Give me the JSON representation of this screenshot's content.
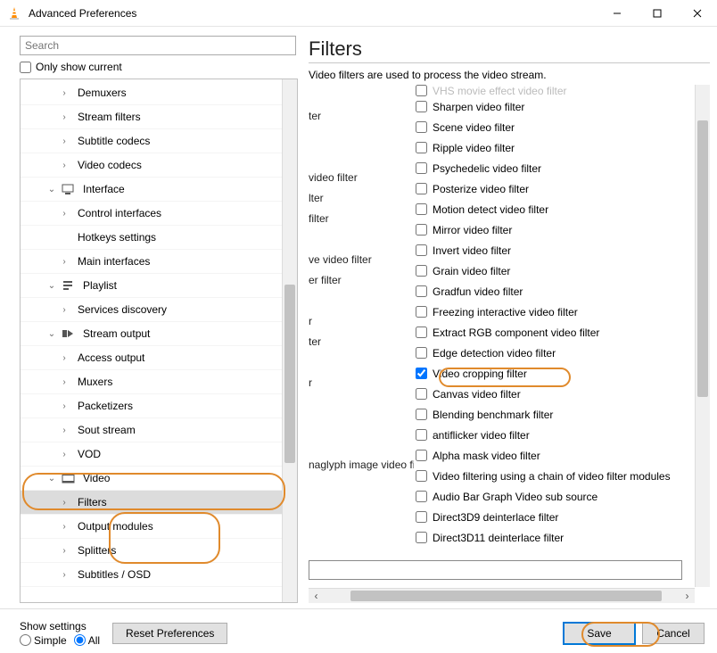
{
  "window": {
    "title": "Advanced Preferences"
  },
  "search": {
    "placeholder": "Search"
  },
  "only_current_label": "Only show current",
  "tree": [
    {
      "level": 2,
      "arrow": "›",
      "label": "Demuxers"
    },
    {
      "level": 2,
      "arrow": "›",
      "label": "Stream filters"
    },
    {
      "level": 2,
      "arrow": "›",
      "label": "Subtitle codecs"
    },
    {
      "level": 2,
      "arrow": "›",
      "label": "Video codecs"
    },
    {
      "level": 1,
      "arrow": "⌄",
      "icon": "iface",
      "label": "Interface"
    },
    {
      "level": 2,
      "arrow": "›",
      "label": "Control interfaces"
    },
    {
      "level": 2,
      "arrow": "",
      "label": "Hotkeys settings"
    },
    {
      "level": 2,
      "arrow": "›",
      "label": "Main interfaces"
    },
    {
      "level": 1,
      "arrow": "⌄",
      "icon": "playlist",
      "label": "Playlist"
    },
    {
      "level": 2,
      "arrow": "›",
      "label": "Services discovery"
    },
    {
      "level": 1,
      "arrow": "⌄",
      "icon": "stream",
      "label": "Stream output"
    },
    {
      "level": 2,
      "arrow": "›",
      "label": "Access output"
    },
    {
      "level": 2,
      "arrow": "›",
      "label": "Muxers"
    },
    {
      "level": 2,
      "arrow": "›",
      "label": "Packetizers"
    },
    {
      "level": 2,
      "arrow": "›",
      "label": "Sout stream"
    },
    {
      "level": 2,
      "arrow": "›",
      "label": "VOD"
    },
    {
      "level": 1,
      "arrow": "⌄",
      "icon": "video",
      "label": "Video"
    },
    {
      "level": 2,
      "arrow": "›",
      "label": "Filters",
      "selected": true
    },
    {
      "level": 2,
      "arrow": "›",
      "label": "Output modules"
    },
    {
      "level": 2,
      "arrow": "›",
      "label": "Splitters"
    },
    {
      "level": 2,
      "arrow": "›",
      "label": "Subtitles / OSD"
    }
  ],
  "right": {
    "heading": "Filters",
    "description": "Video filters are used to process the video stream."
  },
  "filters_left": [
    "",
    "ter",
    "",
    "",
    "video filter",
    "lter",
    "filter",
    "",
    "ve video filter",
    "er filter",
    "",
    "r",
    "ter",
    "",
    "r",
    "",
    "",
    "",
    "naglyph image video filter",
    "",
    "",
    "",
    ""
  ],
  "filters_right": [
    {
      "label": "VHS movie effect video filter",
      "checked": false,
      "cut": true
    },
    {
      "label": "Sharpen video filter",
      "checked": false
    },
    {
      "label": "Scene video filter",
      "checked": false
    },
    {
      "label": "Ripple video filter",
      "checked": false
    },
    {
      "label": "Psychedelic video filter",
      "checked": false
    },
    {
      "label": "Posterize video filter",
      "checked": false
    },
    {
      "label": "Motion detect video filter",
      "checked": false
    },
    {
      "label": "Mirror video filter",
      "checked": false
    },
    {
      "label": "Invert video filter",
      "checked": false
    },
    {
      "label": "Grain video filter",
      "checked": false
    },
    {
      "label": "Gradfun video filter",
      "checked": false
    },
    {
      "label": "Freezing interactive video filter",
      "checked": false
    },
    {
      "label": "Extract RGB component video filter",
      "checked": false
    },
    {
      "label": "Edge detection video filter",
      "checked": false
    },
    {
      "label": "Video cropping filter",
      "checked": true
    },
    {
      "label": "Canvas video filter",
      "checked": false
    },
    {
      "label": "Blending benchmark filter",
      "checked": false
    },
    {
      "label": "antiflicker video filter",
      "checked": false
    },
    {
      "label": "Alpha mask video filter",
      "checked": false
    },
    {
      "label": "Video filtering using a chain of video filter modules",
      "checked": false
    },
    {
      "label": "Audio Bar Graph Video sub source",
      "checked": false
    },
    {
      "label": "Direct3D9 deinterlace filter",
      "checked": false
    },
    {
      "label": "Direct3D11 deinterlace filter",
      "checked": false
    }
  ],
  "bottom": {
    "show_settings_label": "Show settings",
    "radio_simple": "Simple",
    "radio_all": "All",
    "reset": "Reset Preferences",
    "save": "Save",
    "cancel": "Cancel"
  }
}
